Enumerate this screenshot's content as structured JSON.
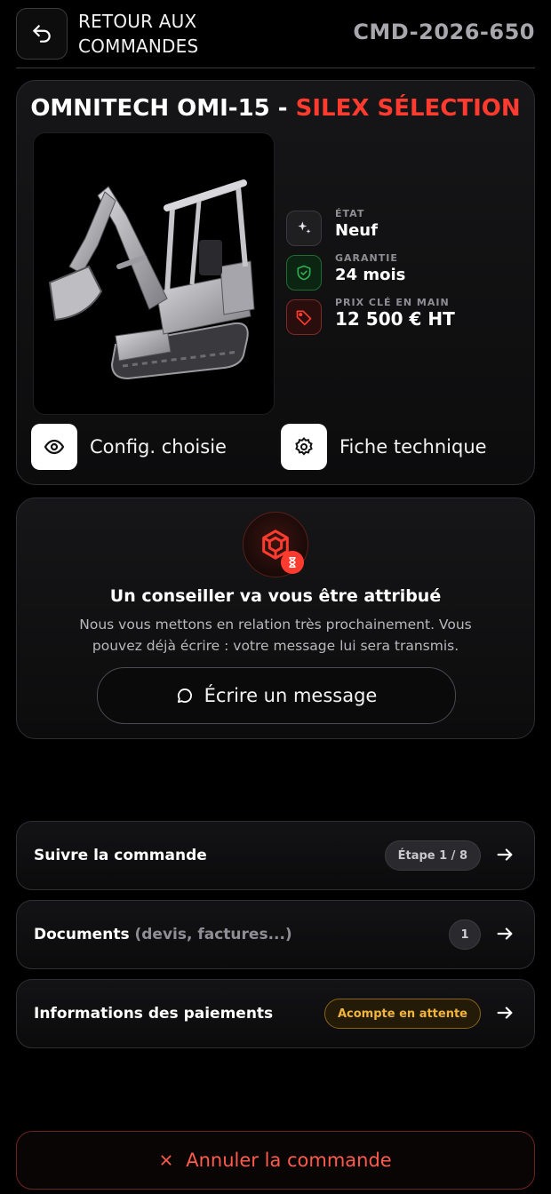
{
  "header": {
    "back_label": "RETOUR AUX COMMANDES",
    "order_id": "CMD-2026-650"
  },
  "product": {
    "title_main": "OMNITECH OMI-15 - ",
    "title_accent": "SILEX SÉLECTION",
    "image_label": "mini-excavator-photo",
    "specs": [
      {
        "label": "ÉTAT",
        "value": "Neuf",
        "icon": "sparkle-icon"
      },
      {
        "label": "GARANTIE",
        "value": "24 mois",
        "icon": "shield-check-icon"
      },
      {
        "label": "PRIX CLÉ EN MAIN",
        "value": "12 500 € HT",
        "icon": "price-tag-icon"
      }
    ],
    "actions": [
      {
        "label": "Config. choisie",
        "icon": "eye-icon"
      },
      {
        "label": "Fiche technique",
        "icon": "gear-icon"
      }
    ]
  },
  "advisor": {
    "title": "Un conseiller va vous être attribué",
    "text": "Nous vous mettons en relation très prochainement. Vous pouvez déjà écrire : votre message lui sera transmis.",
    "button_label": "Écrire un message"
  },
  "rows": [
    {
      "label": "Suivre la commande",
      "muted": "",
      "badge": "Étape 1 / 8"
    },
    {
      "label": "Documents",
      "muted": "(devis, factures...)",
      "badge": "1"
    },
    {
      "label": "Informations des paiements",
      "muted": "",
      "badge": "Acompte en attente"
    }
  ],
  "cancel": {
    "label": "Annuler la commande"
  },
  "colors": {
    "accent": "#ff3b2f",
    "warning": "#f0b43c",
    "success": "#2fae4f",
    "background": "#000000"
  }
}
